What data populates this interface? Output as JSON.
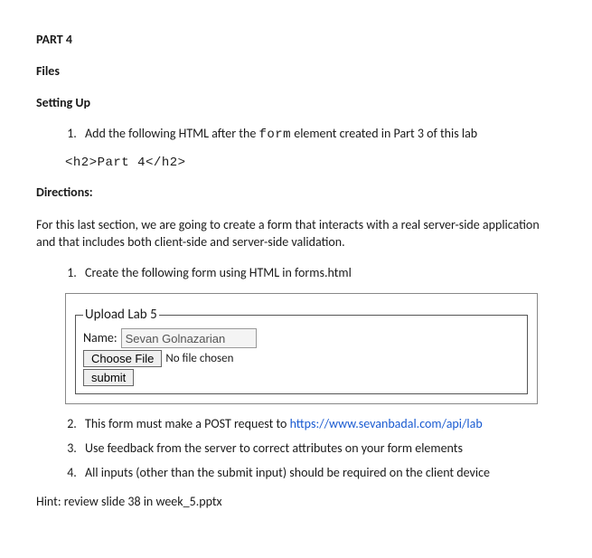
{
  "headings": {
    "part": "PART 4",
    "files": "Files",
    "setup": "Setting Up",
    "directions": "Directions:"
  },
  "setup_item_prefix": "Add the following HTML after the ",
  "setup_item_mono": "form",
  "setup_item_suffix": " element created in Part 3 of this lab",
  "code_line": "<h2>Part 4</h2>",
  "intro_para": "For this last section, we are going to create a form that interacts with a real server-side application and that includes both client-side and server-side validation.",
  "directions_items": {
    "d1": "Create the following form using HTML in forms.html",
    "d2_prefix": "This form must make a POST request to ",
    "d2_link": "https://www.sevanbadal.com/api/lab",
    "d3": "Use feedback from the server to correct attributes on your form elements",
    "d4": "All inputs (other than the submit input) should be required on the client device"
  },
  "form": {
    "legend": "Upload Lab 5",
    "name_label": "Name:",
    "name_value": "Sevan Golnazarian",
    "choose_file": "Choose File",
    "no_file": "No file chosen",
    "submit": "submit"
  },
  "hint": "Hint: review slide 38 in week_5.pptx"
}
